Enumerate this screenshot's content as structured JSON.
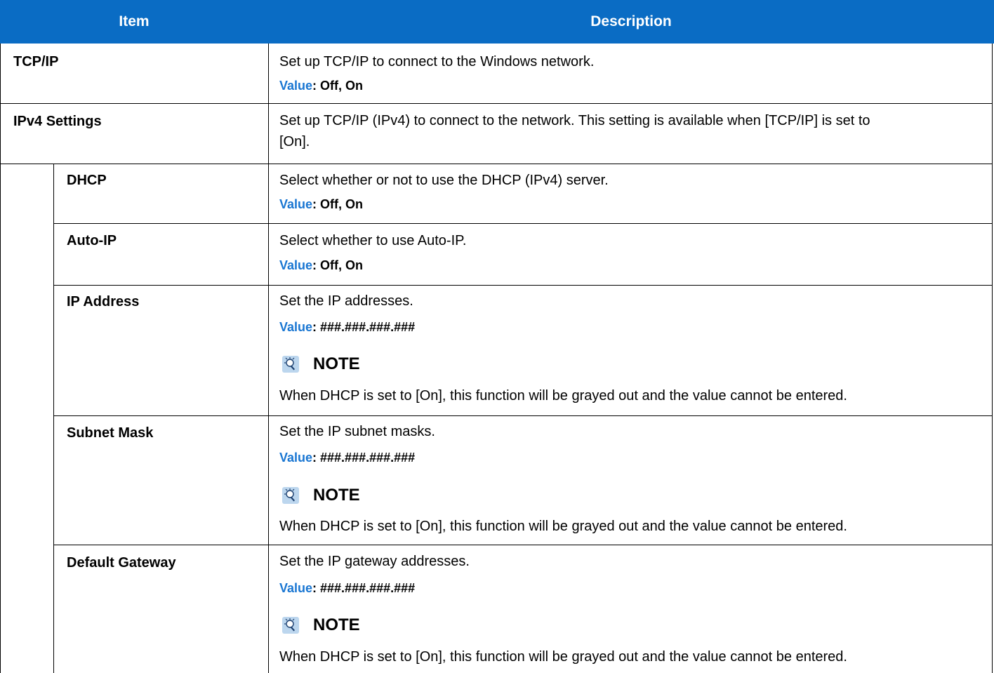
{
  "header": {
    "item": "Item",
    "description": "Description"
  },
  "rows": {
    "tcpip": {
      "label": "TCP/IP",
      "description": "Set up TCP/IP to connect to the Windows network.",
      "value_label": "Value",
      "value": ": Off, On"
    },
    "ipv4": {
      "label": "IPv4 Settings",
      "description_line1": "Set up TCP/IP (IPv4) to connect to the network. This setting is available when [TCP/IP] is set to",
      "description_line2": "[On]."
    },
    "dhcp": {
      "label": "DHCP",
      "description": "Select whether or not to use the DHCP (IPv4) server.",
      "value_label": "Value",
      "value": ": Off, On"
    },
    "autoip": {
      "label": "Auto-IP",
      "description": "Select whether to use Auto-IP.",
      "value_label": "Value",
      "value": ": Off, On"
    },
    "ipaddress": {
      "label": "IP Address",
      "description": "Set the IP addresses.",
      "value_label": "Value",
      "value": ": ###.###.###.###",
      "note_label": "NOTE",
      "note": "When DHCP is set to [On], this function will be grayed out and the value cannot be entered."
    },
    "subnet": {
      "label": "Subnet Mask",
      "description": "Set the IP subnet masks.",
      "value_label": "Value",
      "value": ": ###.###.###.###",
      "note_label": "NOTE",
      "note": "When DHCP is set to [On], this function will be grayed out and the value cannot be entered."
    },
    "gateway": {
      "label": "Default Gateway",
      "description": "Set the IP gateway addresses.",
      "value_label": "Value",
      "value": ": ###.###.###.###",
      "note_label": "NOTE",
      "note": "When DHCP is set to [On], this function will be grayed out and the value cannot be entered."
    }
  },
  "icons": {
    "note": "note-lightbulb-icon"
  },
  "colors": {
    "header_bg": "#0a6cc4",
    "value_accent": "#1976d2"
  }
}
